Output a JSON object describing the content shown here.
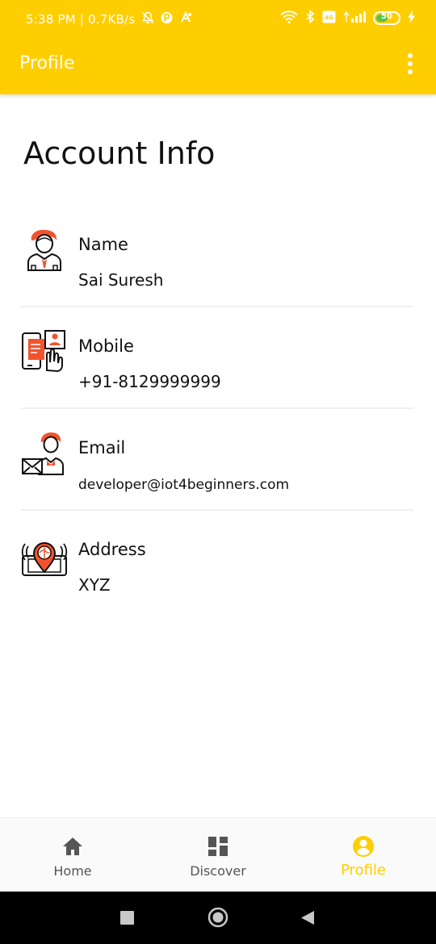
{
  "status_bar": {
    "left_text": "5:38 PM | 0.7KB/s",
    "battery_level": "50"
  },
  "app_bar": {
    "title": "Profile",
    "menu_icon": "more-vert-icon"
  },
  "section_title": "Account Info",
  "info_items": [
    {
      "label": "Name",
      "value": "Sai Suresh",
      "icon": "person-avatar-icon"
    },
    {
      "label": "Mobile",
      "value": "+91-8129999999",
      "icon": "mobile-touch-icon"
    },
    {
      "label": "Email",
      "value": "developer@iot4beginners.com",
      "icon": "person-mail-icon"
    },
    {
      "label": "Address",
      "value": "XYZ",
      "icon": "location-pin-phone-icon"
    }
  ],
  "bottom_nav": [
    {
      "label": "Home",
      "icon": "home-icon",
      "active": false
    },
    {
      "label": "Discover",
      "icon": "dashboard-icon",
      "active": false
    },
    {
      "label": "Profile",
      "icon": "account-circle-icon",
      "active": true
    }
  ],
  "colors": {
    "primary": "#FFCE00",
    "icon_accent": "#F2532D",
    "text": "#111111"
  }
}
